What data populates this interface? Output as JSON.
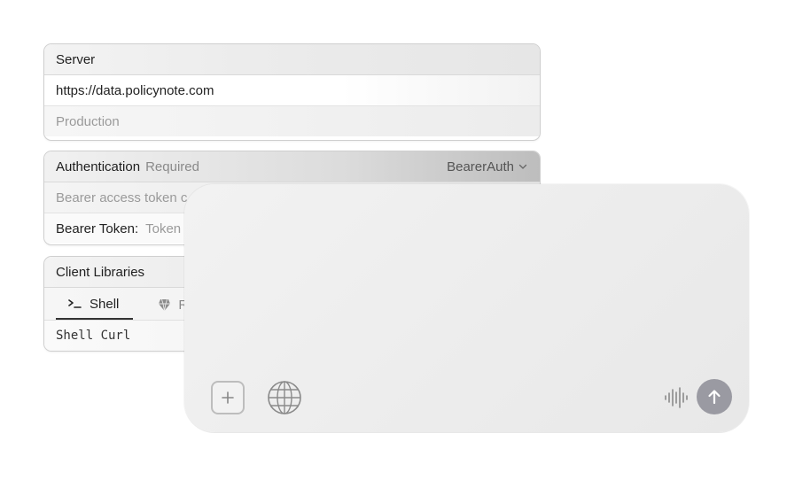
{
  "server": {
    "title": "Server",
    "url": "https://data.policynote.com",
    "environment": "Production"
  },
  "auth": {
    "title": "Authentication",
    "required_label": "Required",
    "scheme": "BearerAuth",
    "description": "Bearer access token c",
    "token_label": "Bearer Token:",
    "token_placeholder": "Token"
  },
  "libraries": {
    "title": "Client Libraries",
    "tabs": [
      {
        "label": "Shell",
        "icon": "terminal-icon",
        "active": true
      },
      {
        "label": "Ru",
        "icon": "ruby-icon",
        "active": false
      }
    ],
    "code": "Shell Curl"
  },
  "composer": {
    "add_icon": "plus-icon",
    "globe_icon": "globe-icon",
    "voice_icon": "waveform-icon",
    "send_icon": "arrow-up-icon",
    "send_color": "#9a9aa2"
  }
}
